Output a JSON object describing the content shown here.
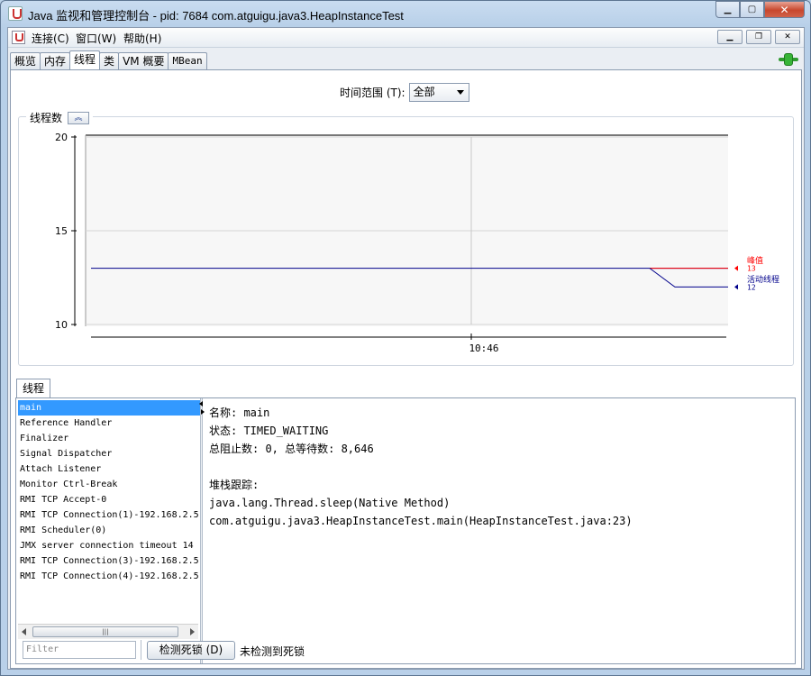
{
  "window": {
    "title": "Java 监视和管理控制台 - pid: 7684 com.atguigu.java3.HeapInstanceTest"
  },
  "menu": {
    "items": [
      "连接(C)",
      "窗口(W)",
      "帮助(H)"
    ]
  },
  "tabs": [
    "概览",
    "内存",
    "线程",
    "类",
    "VM 概要",
    "MBean"
  ],
  "time_range": {
    "label": "时间范围 (T):",
    "value": "全部"
  },
  "chart_title": "线程数",
  "chart_data": {
    "type": "line",
    "x_tick_labels": [
      "10:46"
    ],
    "y_tick_labels": [
      "20",
      "15",
      "10"
    ],
    "ylim": [
      10,
      20
    ],
    "series": [
      {
        "name": "峰值",
        "color": "#ff0000",
        "last_value": "13",
        "values": [
          13,
          13,
          13
        ]
      },
      {
        "name": "活动线程",
        "color": "#00008b",
        "last_value": "12",
        "values": [
          13,
          13,
          12
        ]
      }
    ],
    "legend": "right"
  },
  "threads_tab_label": "线程",
  "threads": [
    "main",
    "Reference Handler",
    "Finalizer",
    "Signal Dispatcher",
    "Attach Listener",
    "Monitor Ctrl-Break",
    "RMI TCP Accept-0",
    "RMI TCP Connection(1)-192.168.2.5",
    "RMI Scheduler(0)",
    "JMX server connection timeout 14",
    "RMI TCP Connection(3)-192.168.2.5",
    "RMI TCP Connection(4)-192.168.2.5"
  ],
  "thread_detail": {
    "name": "名称: main",
    "state": "状态: TIMED_WAITING",
    "counts": "总阻止数: 0, 总等待数: 8,646",
    "stack_label": "堆栈跟踪:",
    "stack": [
      "java.lang.Thread.sleep(Native Method)",
      "com.atguigu.java3.HeapInstanceTest.main(HeapInstanceTest.java:23)"
    ]
  },
  "filter_placeholder": "Filter",
  "deadlock_button": "检测死锁 (D)",
  "deadlock_status": "未检测到死锁"
}
